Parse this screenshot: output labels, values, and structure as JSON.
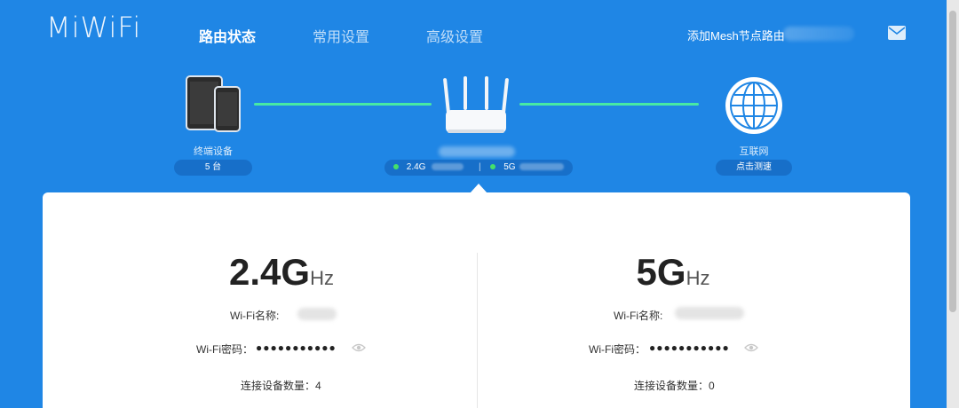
{
  "header": {
    "logo": "MiWiFi",
    "tabs": [
      {
        "label": "路由状态",
        "active": true
      },
      {
        "label": "常用设置",
        "active": false
      },
      {
        "label": "高级设置",
        "active": false
      }
    ],
    "mesh_link": "添加Mesh节点路由",
    "mail_icon": "mail-icon"
  },
  "topology": {
    "devices": {
      "label": "终端设备",
      "count": "5 台",
      "icon": "devices-icon"
    },
    "router": {
      "icon": "router-icon",
      "band_24": "2.4G",
      "band_5": "5G"
    },
    "internet": {
      "label": "互联网",
      "action": "点击测速",
      "icon": "globe-icon"
    },
    "link_color": "#48e9a4"
  },
  "bands": [
    {
      "freq": "2.4G",
      "unit": "Hz",
      "wifi_name_label": "Wi-Fi名称:",
      "wifi_pwd_label": "Wi-Fi密码：",
      "wifi_pwd_value": "●●●●●●●●●●●",
      "connected_label": "连接设备数量：",
      "connected_count": "4"
    },
    {
      "freq": "5G",
      "unit": "Hz",
      "wifi_name_label": "Wi-Fi名称:",
      "wifi_pwd_label": "Wi-Fi密码：",
      "wifi_pwd_value": "●●●●●●●●●●●",
      "connected_label": "连接设备数量：",
      "connected_count": "0"
    }
  ],
  "colors": {
    "background": "#1f86e5",
    "accent_green": "#44e06a"
  }
}
